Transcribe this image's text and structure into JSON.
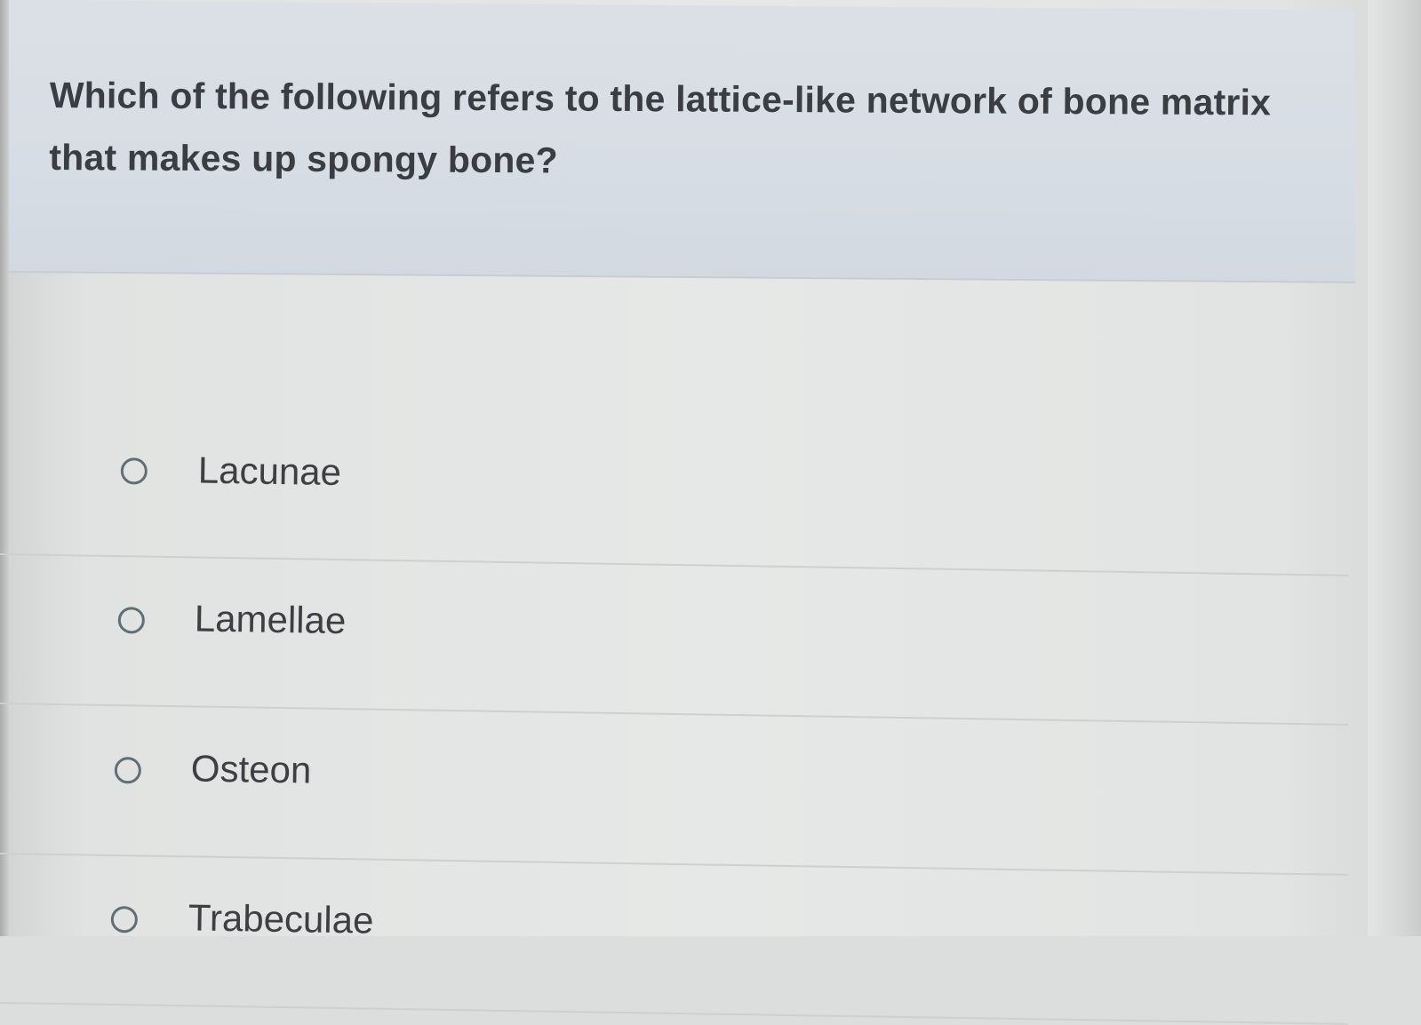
{
  "question": {
    "text": "Which of the following refers to the lattice-like network of bone matrix that makes up spongy bone?"
  },
  "options": [
    {
      "label": "Lacunae",
      "selected": false
    },
    {
      "label": "Lamellae",
      "selected": false
    },
    {
      "label": "Osteon",
      "selected": false
    },
    {
      "label": "Trabeculae",
      "selected": false
    }
  ],
  "colors": {
    "question_panel_bg": "#d7dde4",
    "question_text": "#3a3d42",
    "option_text": "#3d4043",
    "radio_border": "#5f6f73",
    "page_bg": "#e4e6e5"
  }
}
